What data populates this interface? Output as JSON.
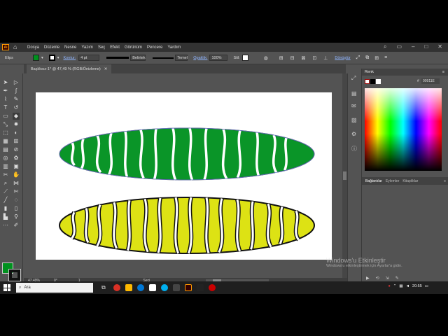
{
  "menubar": {
    "logo": "Ai",
    "items": [
      "Dosya",
      "Düzenle",
      "Nesne",
      "Yazım",
      "Seç",
      "Efekt",
      "Görünüm",
      "Pencere",
      "Yardım"
    ]
  },
  "control": {
    "object_type": "Elips",
    "stroke_label": "Kontur:",
    "stroke_weight": "4 pt",
    "brush_label": "Belirtek",
    "profile_label": "Temel",
    "opacity_label": "Opaklık:",
    "opacity_value": "100%",
    "style_label": "Stil:",
    "transform_link": "Dönüştür"
  },
  "document": {
    "tab_title": "Başlıksız-1* @ 47,49 % (RGB/Önizleme)",
    "zoom": "47,49%",
    "rotation": "0°",
    "page": "1",
    "tool_status": "Seçi"
  },
  "panel": {
    "title": "Renk",
    "hex_value": "00911E",
    "tabs": [
      "Bağlantılar",
      "Eylemler",
      "Kitaplıklar"
    ]
  },
  "colors": {
    "fill": "#00911e",
    "leaf_top": "#0a9528",
    "leaf_bottom": "#dde214"
  },
  "taskbar": {
    "search_placeholder": "Ara",
    "time": "20:55"
  },
  "watermark": {
    "title": "Windows'u Etkinleştir",
    "subtitle": "Windows'u etkinleştirmek için Ayarlar'a gidin."
  }
}
